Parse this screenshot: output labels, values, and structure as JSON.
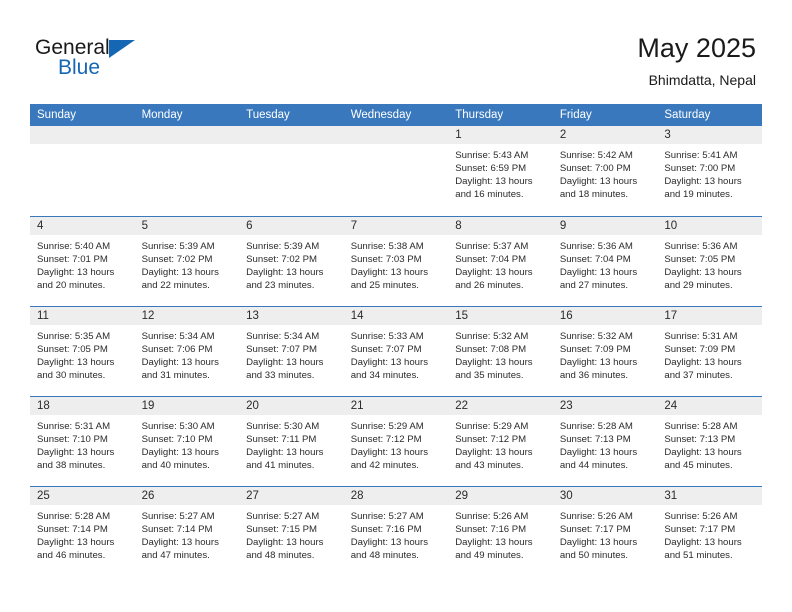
{
  "brand": {
    "name_part1": "General",
    "name_part2": "Blue",
    "flag_icon": "triangle-flag-icon"
  },
  "header": {
    "title": "May 2025",
    "location": "Bhimdatta, Nepal"
  },
  "calendar": {
    "weekday_headers": [
      "Sunday",
      "Monday",
      "Tuesday",
      "Wednesday",
      "Thursday",
      "Friday",
      "Saturday"
    ],
    "accent_color": "#3a78bd",
    "daynum_background": "#eeeeee",
    "weeks": [
      [
        {
          "day": "",
          "blank": true
        },
        {
          "day": "",
          "blank": true
        },
        {
          "day": "",
          "blank": true
        },
        {
          "day": "",
          "blank": true
        },
        {
          "day": "1",
          "sunrise": "Sunrise: 5:43 AM",
          "sunset": "Sunset: 6:59 PM",
          "daylight": "Daylight: 13 hours and 16 minutes."
        },
        {
          "day": "2",
          "sunrise": "Sunrise: 5:42 AM",
          "sunset": "Sunset: 7:00 PM",
          "daylight": "Daylight: 13 hours and 18 minutes."
        },
        {
          "day": "3",
          "sunrise": "Sunrise: 5:41 AM",
          "sunset": "Sunset: 7:00 PM",
          "daylight": "Daylight: 13 hours and 19 minutes."
        }
      ],
      [
        {
          "day": "4",
          "sunrise": "Sunrise: 5:40 AM",
          "sunset": "Sunset: 7:01 PM",
          "daylight": "Daylight: 13 hours and 20 minutes."
        },
        {
          "day": "5",
          "sunrise": "Sunrise: 5:39 AM",
          "sunset": "Sunset: 7:02 PM",
          "daylight": "Daylight: 13 hours and 22 minutes."
        },
        {
          "day": "6",
          "sunrise": "Sunrise: 5:39 AM",
          "sunset": "Sunset: 7:02 PM",
          "daylight": "Daylight: 13 hours and 23 minutes."
        },
        {
          "day": "7",
          "sunrise": "Sunrise: 5:38 AM",
          "sunset": "Sunset: 7:03 PM",
          "daylight": "Daylight: 13 hours and 25 minutes."
        },
        {
          "day": "8",
          "sunrise": "Sunrise: 5:37 AM",
          "sunset": "Sunset: 7:04 PM",
          "daylight": "Daylight: 13 hours and 26 minutes."
        },
        {
          "day": "9",
          "sunrise": "Sunrise: 5:36 AM",
          "sunset": "Sunset: 7:04 PM",
          "daylight": "Daylight: 13 hours and 27 minutes."
        },
        {
          "day": "10",
          "sunrise": "Sunrise: 5:36 AM",
          "sunset": "Sunset: 7:05 PM",
          "daylight": "Daylight: 13 hours and 29 minutes."
        }
      ],
      [
        {
          "day": "11",
          "sunrise": "Sunrise: 5:35 AM",
          "sunset": "Sunset: 7:05 PM",
          "daylight": "Daylight: 13 hours and 30 minutes."
        },
        {
          "day": "12",
          "sunrise": "Sunrise: 5:34 AM",
          "sunset": "Sunset: 7:06 PM",
          "daylight": "Daylight: 13 hours and 31 minutes."
        },
        {
          "day": "13",
          "sunrise": "Sunrise: 5:34 AM",
          "sunset": "Sunset: 7:07 PM",
          "daylight": "Daylight: 13 hours and 33 minutes."
        },
        {
          "day": "14",
          "sunrise": "Sunrise: 5:33 AM",
          "sunset": "Sunset: 7:07 PM",
          "daylight": "Daylight: 13 hours and 34 minutes."
        },
        {
          "day": "15",
          "sunrise": "Sunrise: 5:32 AM",
          "sunset": "Sunset: 7:08 PM",
          "daylight": "Daylight: 13 hours and 35 minutes."
        },
        {
          "day": "16",
          "sunrise": "Sunrise: 5:32 AM",
          "sunset": "Sunset: 7:09 PM",
          "daylight": "Daylight: 13 hours and 36 minutes."
        },
        {
          "day": "17",
          "sunrise": "Sunrise: 5:31 AM",
          "sunset": "Sunset: 7:09 PM",
          "daylight": "Daylight: 13 hours and 37 minutes."
        }
      ],
      [
        {
          "day": "18",
          "sunrise": "Sunrise: 5:31 AM",
          "sunset": "Sunset: 7:10 PM",
          "daylight": "Daylight: 13 hours and 38 minutes."
        },
        {
          "day": "19",
          "sunrise": "Sunrise: 5:30 AM",
          "sunset": "Sunset: 7:10 PM",
          "daylight": "Daylight: 13 hours and 40 minutes."
        },
        {
          "day": "20",
          "sunrise": "Sunrise: 5:30 AM",
          "sunset": "Sunset: 7:11 PM",
          "daylight": "Daylight: 13 hours and 41 minutes."
        },
        {
          "day": "21",
          "sunrise": "Sunrise: 5:29 AM",
          "sunset": "Sunset: 7:12 PM",
          "daylight": "Daylight: 13 hours and 42 minutes."
        },
        {
          "day": "22",
          "sunrise": "Sunrise: 5:29 AM",
          "sunset": "Sunset: 7:12 PM",
          "daylight": "Daylight: 13 hours and 43 minutes."
        },
        {
          "day": "23",
          "sunrise": "Sunrise: 5:28 AM",
          "sunset": "Sunset: 7:13 PM",
          "daylight": "Daylight: 13 hours and 44 minutes."
        },
        {
          "day": "24",
          "sunrise": "Sunrise: 5:28 AM",
          "sunset": "Sunset: 7:13 PM",
          "daylight": "Daylight: 13 hours and 45 minutes."
        }
      ],
      [
        {
          "day": "25",
          "sunrise": "Sunrise: 5:28 AM",
          "sunset": "Sunset: 7:14 PM",
          "daylight": "Daylight: 13 hours and 46 minutes."
        },
        {
          "day": "26",
          "sunrise": "Sunrise: 5:27 AM",
          "sunset": "Sunset: 7:14 PM",
          "daylight": "Daylight: 13 hours and 47 minutes."
        },
        {
          "day": "27",
          "sunrise": "Sunrise: 5:27 AM",
          "sunset": "Sunset: 7:15 PM",
          "daylight": "Daylight: 13 hours and 48 minutes."
        },
        {
          "day": "28",
          "sunrise": "Sunrise: 5:27 AM",
          "sunset": "Sunset: 7:16 PM",
          "daylight": "Daylight: 13 hours and 48 minutes."
        },
        {
          "day": "29",
          "sunrise": "Sunrise: 5:26 AM",
          "sunset": "Sunset: 7:16 PM",
          "daylight": "Daylight: 13 hours and 49 minutes."
        },
        {
          "day": "30",
          "sunrise": "Sunrise: 5:26 AM",
          "sunset": "Sunset: 7:17 PM",
          "daylight": "Daylight: 13 hours and 50 minutes."
        },
        {
          "day": "31",
          "sunrise": "Sunrise: 5:26 AM",
          "sunset": "Sunset: 7:17 PM",
          "daylight": "Daylight: 13 hours and 51 minutes."
        }
      ]
    ]
  }
}
